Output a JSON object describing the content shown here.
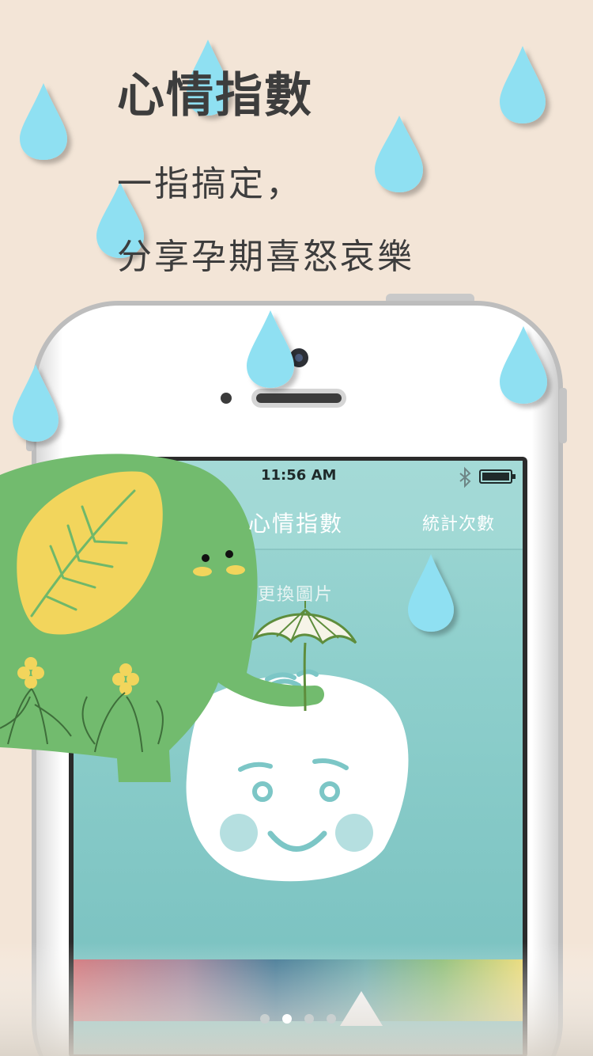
{
  "promo": {
    "title": "心情指數",
    "line1": "一指搞定，",
    "line2": "分享孕期喜怒哀樂"
  },
  "phone": {
    "status_time": "11:56 AM",
    "nav_title": "心情指數",
    "nav_right_button": "統計次數",
    "change_image_label": "更換圖片",
    "page_indicator": {
      "count": 4,
      "active_index": 1
    }
  },
  "colors": {
    "background": "#f3e5d7",
    "raindrop": "#8fe0f2",
    "screen_teal": "#7fc3c2",
    "elephant_green": "#72bb6e",
    "leaf_yellow": "#f2d55c",
    "face_teal": "#7cc6c6"
  },
  "icons": [
    "bluetooth-icon",
    "battery-icon",
    "umbrella-icon",
    "camera-icon",
    "raindrop-icon",
    "elephant-illustration",
    "smiley-face-illustration"
  ]
}
